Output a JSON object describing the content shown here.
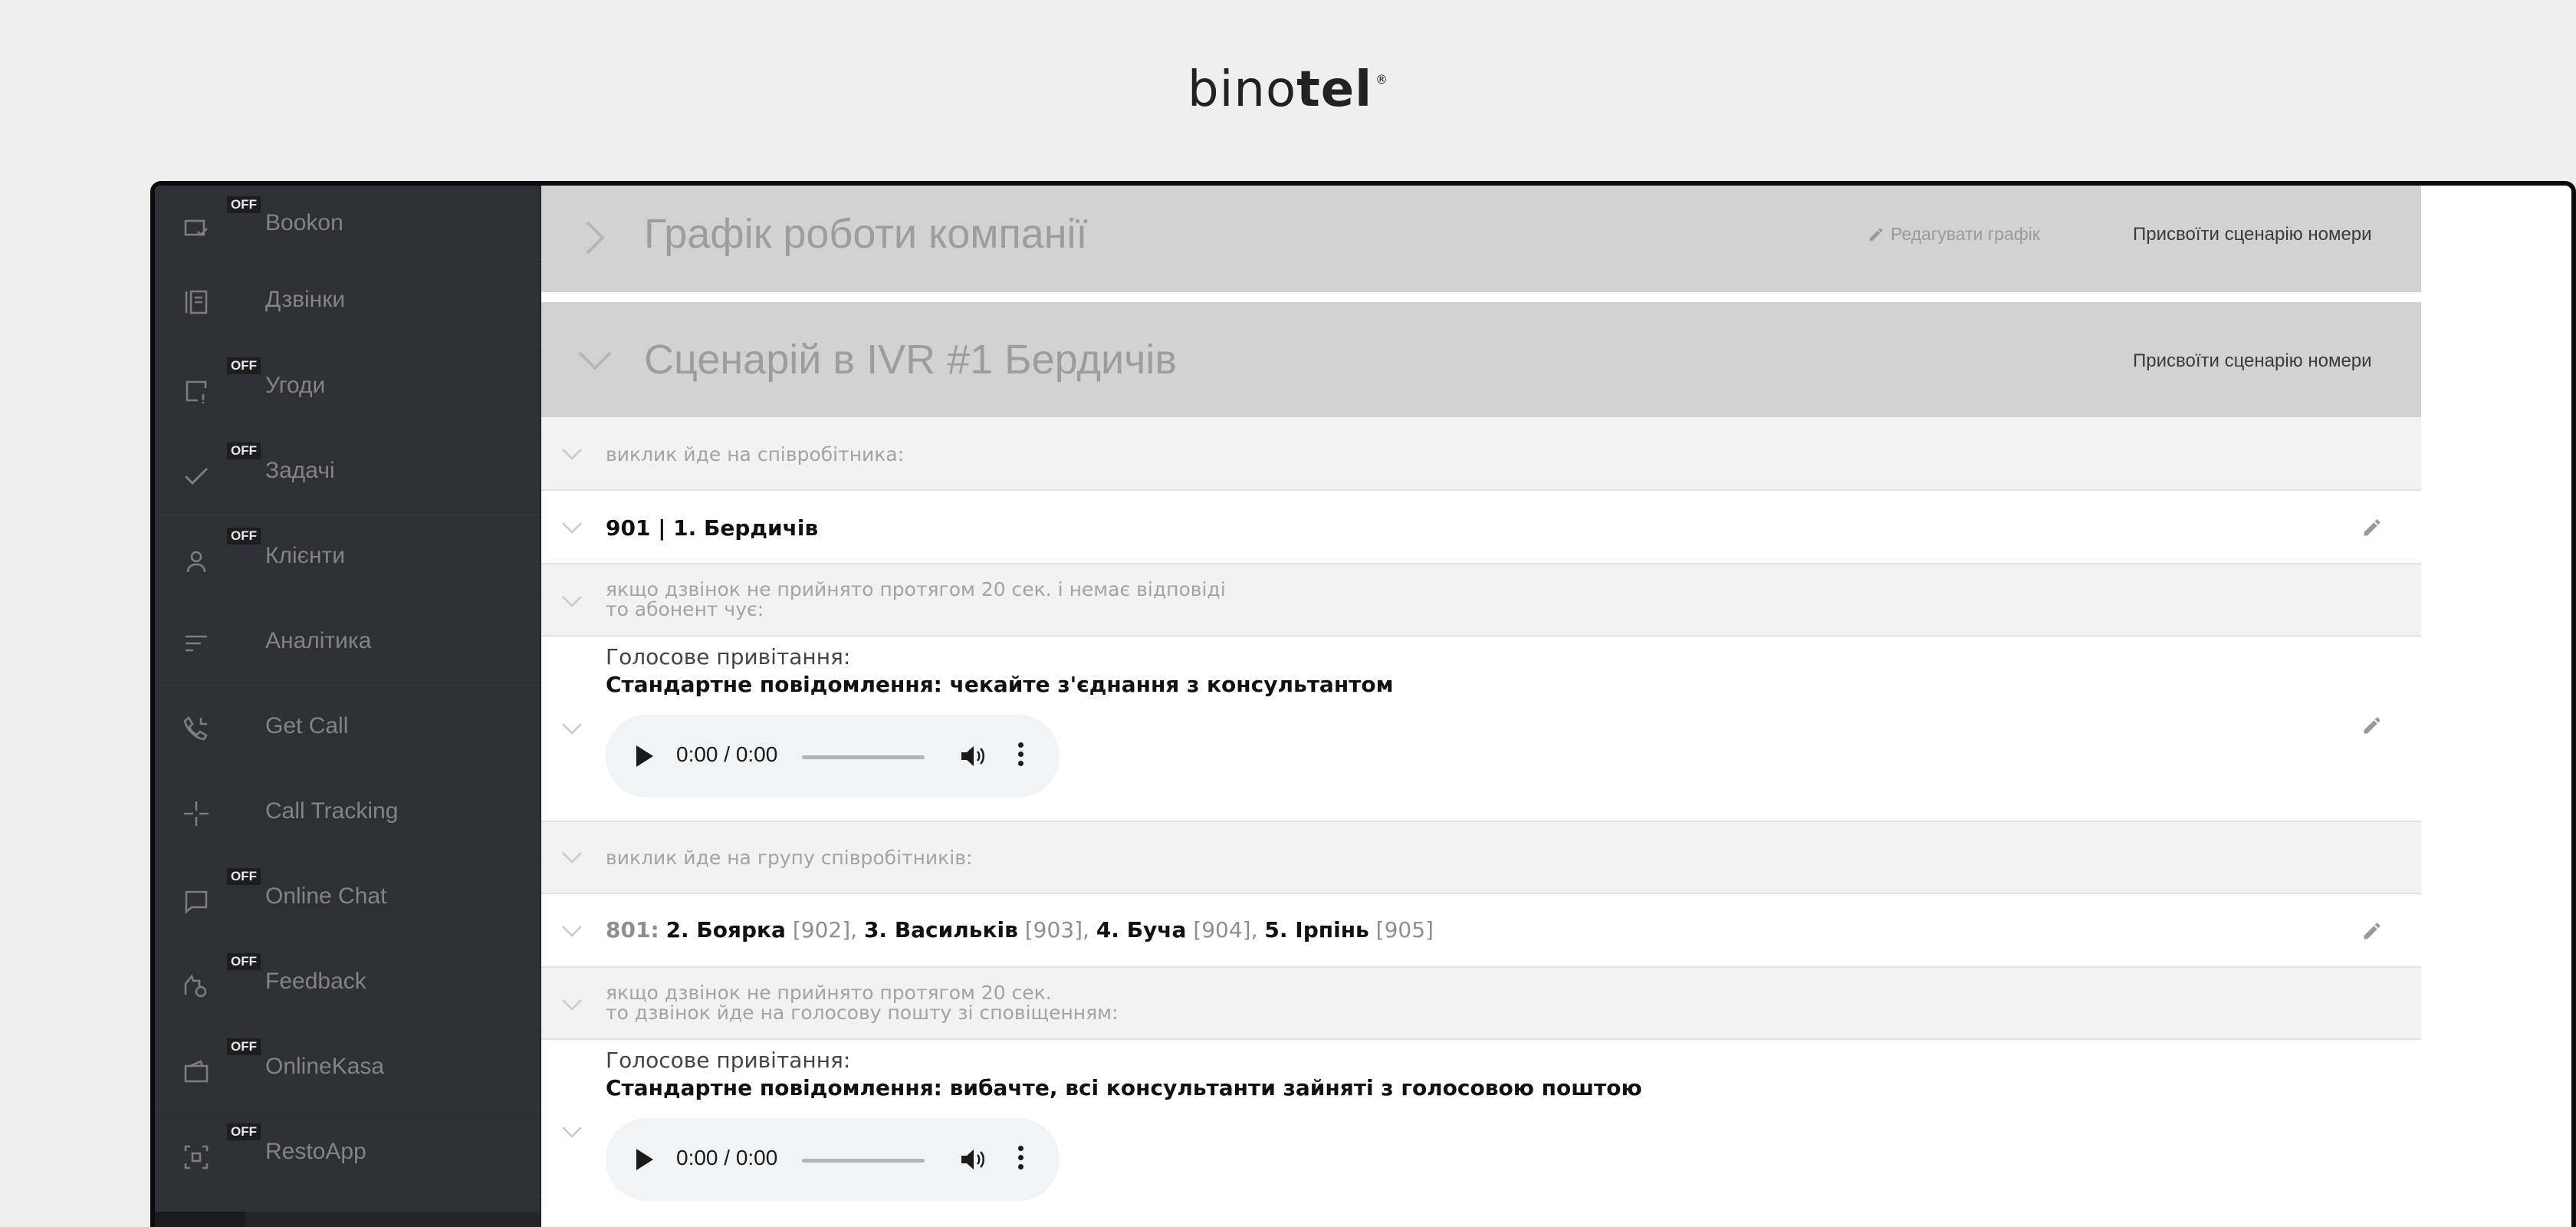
{
  "brand": {
    "logo_light": "bino",
    "logo_bold": "tel",
    "logo_mark": "®"
  },
  "sidebar": {
    "items": [
      {
        "label": "Bookon",
        "icon": "bookon-icon",
        "off": "OFF"
      },
      {
        "label": "Дзвінки",
        "icon": "calls-icon",
        "off": ""
      },
      {
        "label": "Угоди",
        "icon": "deals-icon",
        "off": "OFF"
      },
      {
        "label": "Задачі",
        "icon": "tasks-icon",
        "off": "OFF"
      },
      {
        "label": "Клієнти",
        "icon": "clients-icon",
        "off": "OFF"
      },
      {
        "label": "Аналітика",
        "icon": "analytics-icon",
        "off": ""
      },
      {
        "label": "Get Call",
        "icon": "get-call-icon",
        "off": ""
      },
      {
        "label": "Call Tracking",
        "icon": "call-tracking-icon",
        "off": ""
      },
      {
        "label": "Online Chat",
        "icon": "online-chat-icon",
        "off": "OFF"
      },
      {
        "label": "Feedback",
        "icon": "feedback-icon",
        "off": "OFF"
      },
      {
        "label": "OnlineKasa",
        "icon": "online-kasa-icon",
        "off": "OFF"
      },
      {
        "label": "RestoApp",
        "icon": "resto-app-icon",
        "off": "OFF"
      }
    ]
  },
  "schedule": {
    "title": "Графік роботи компанії",
    "edit_label": "Редагувати графік",
    "assign_label": "Присвоїти сценарію номери"
  },
  "scenario": {
    "title": "Сценарій в IVR #1 Бердичів",
    "assign_label": "Присвоїти сценарію номери",
    "rows": {
      "employee_call": "виклик йде на співробітника:",
      "employee": "901 | 1. Бердичів",
      "noanswer1_line1": "якщо дзвінок не прийнято протягом 20 сек. і немає відповіді",
      "noanswer1_line2": "то абонент чує:",
      "greeting1_title": "Голосове привітання:",
      "greeting1_msg": "Стандартне повідомлення: чекайте з'єднання з консультантом",
      "group_call": "виклик йде на групу співробітників:",
      "group": {
        "num": "801:",
        "m1_name": "2. Боярка",
        "m1_num": "[902],",
        "m2_name": "3. Васильків",
        "m2_num": "[903],",
        "m3_name": "4. Буча",
        "m3_num": "[904],",
        "m4_name": "5. Ірпінь",
        "m4_num": "[905]"
      },
      "noanswer2_line1": "якщо дзвінок не прийнято протягом 20 сек.",
      "noanswer2_line2": "то дзвінок йде на голосову пошту зі сповіщенням:",
      "greeting2_title": "Голосове привітання:",
      "greeting2_msg": "Стандартне повідомлення: вибачте, всі консультанти зайняті з голосовою поштою"
    }
  },
  "player1": {
    "time": "0:00 / 0:00"
  },
  "player2": {
    "time": "0:00 / 0:00"
  }
}
